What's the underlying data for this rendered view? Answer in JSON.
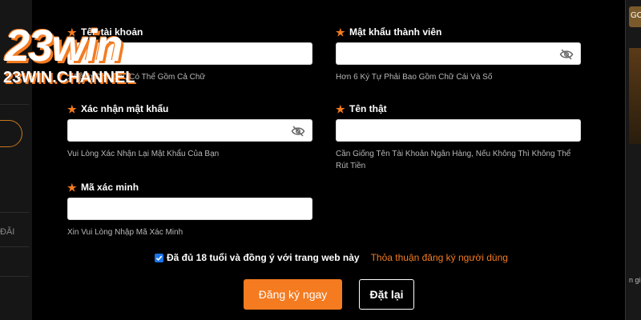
{
  "brand": {
    "logo_big": "23win",
    "logo_small": "23WIN.CHANNEL"
  },
  "form": {
    "username": {
      "label": "Tên tài khoản",
      "hint": "...Bằng Chữ Cái, Có Thể Gồm Cả Chữ"
    },
    "password": {
      "label": "Mật khẩu thành viên",
      "hint": "Hơn 6 Ký Tự Phải Bao Gồm Chữ Cái Và Số"
    },
    "confirm_password": {
      "label": "Xác nhận mật khẩu",
      "hint": "Vui Lòng Xác Nhận Lại Mật Khẩu Của Bạn"
    },
    "real_name": {
      "label": "Tên thật",
      "hint": "Cần Giống Tên Tài Khoản Ngân Hàng, Nếu Không Thì Không Thể Rút Tiền"
    },
    "captcha": {
      "label": "Mã xác minh",
      "hint": "Xin Vui Lòng Nhập Mã Xác Minh"
    },
    "agree": {
      "text": "Đã đủ 18 tuổi và đồng ý với trang web này",
      "checked": true,
      "link": "Thỏa thuận đăng ký người dùng"
    },
    "submit_label": "Đăng ký ngay",
    "reset_label": "Đặt lại"
  },
  "background": {
    "left_fragment": "ĐĂI",
    "right_badge": "GO",
    "right_fragment": "n gi"
  },
  "colors": {
    "accent": "#f47b20",
    "background": "#000000",
    "checkbox": "#1a73e8"
  }
}
